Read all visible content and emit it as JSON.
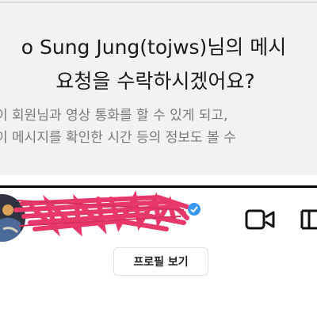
{
  "request_dialog": {
    "headline_line1": "o Sung Jung(tojws)님의 메시",
    "headline_line2": "요청을 수락하시겠어요?",
    "description_line1": "이 회원님과 영상 통화를 할 수 있게 되고,",
    "description_line2": "이 메시지를 확인한 시간 등의 정보도 볼 수"
  },
  "profile_header": {
    "verified_badge_color": "#3897f0",
    "redaction_color": "#e8386a",
    "icons": [
      "video-call-icon",
      "info-icon"
    ]
  },
  "profile_button": {
    "label": "프로필 보기"
  }
}
